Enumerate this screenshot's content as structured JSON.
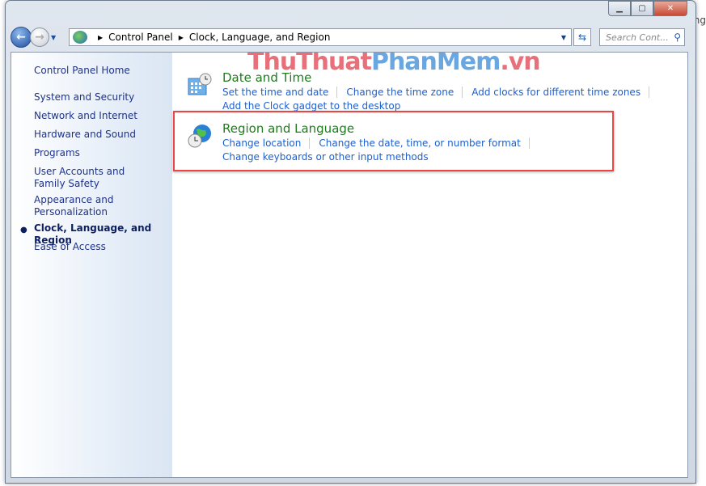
{
  "background_text": "ng",
  "window": {
    "caption_buttons": [
      "minimize",
      "maximize",
      "close"
    ]
  },
  "address_bar": {
    "breadcrumb": [
      "Control Panel",
      "Clock, Language, and Region"
    ],
    "search_placeholder": "Search Cont..."
  },
  "watermark": {
    "part1": "ThuThuat",
    "part2": "PhanMem",
    "part3": ".vn"
  },
  "sidebar": {
    "home": "Control Panel Home",
    "items": [
      "System and Security",
      "Network and Internet",
      "Hardware and Sound",
      "Programs",
      "User Accounts and Family Safety",
      "Appearance and Personalization",
      "Clock, Language, and Region",
      "Ease of Access"
    ],
    "current": "Clock, Language, and Region"
  },
  "categories": [
    {
      "title": "Date and Time",
      "icon": "calendar-clock-icon",
      "links": [
        "Set the time and date",
        "Change the time zone",
        "Add clocks for different time zones",
        "Add the Clock gadget to the desktop"
      ]
    },
    {
      "title": "Region and Language",
      "icon": "globe-clock-icon",
      "links": [
        "Change location",
        "Change the date, time, or number format",
        "Change keyboards or other input methods"
      ]
    }
  ],
  "highlight_color": "#ef4444"
}
